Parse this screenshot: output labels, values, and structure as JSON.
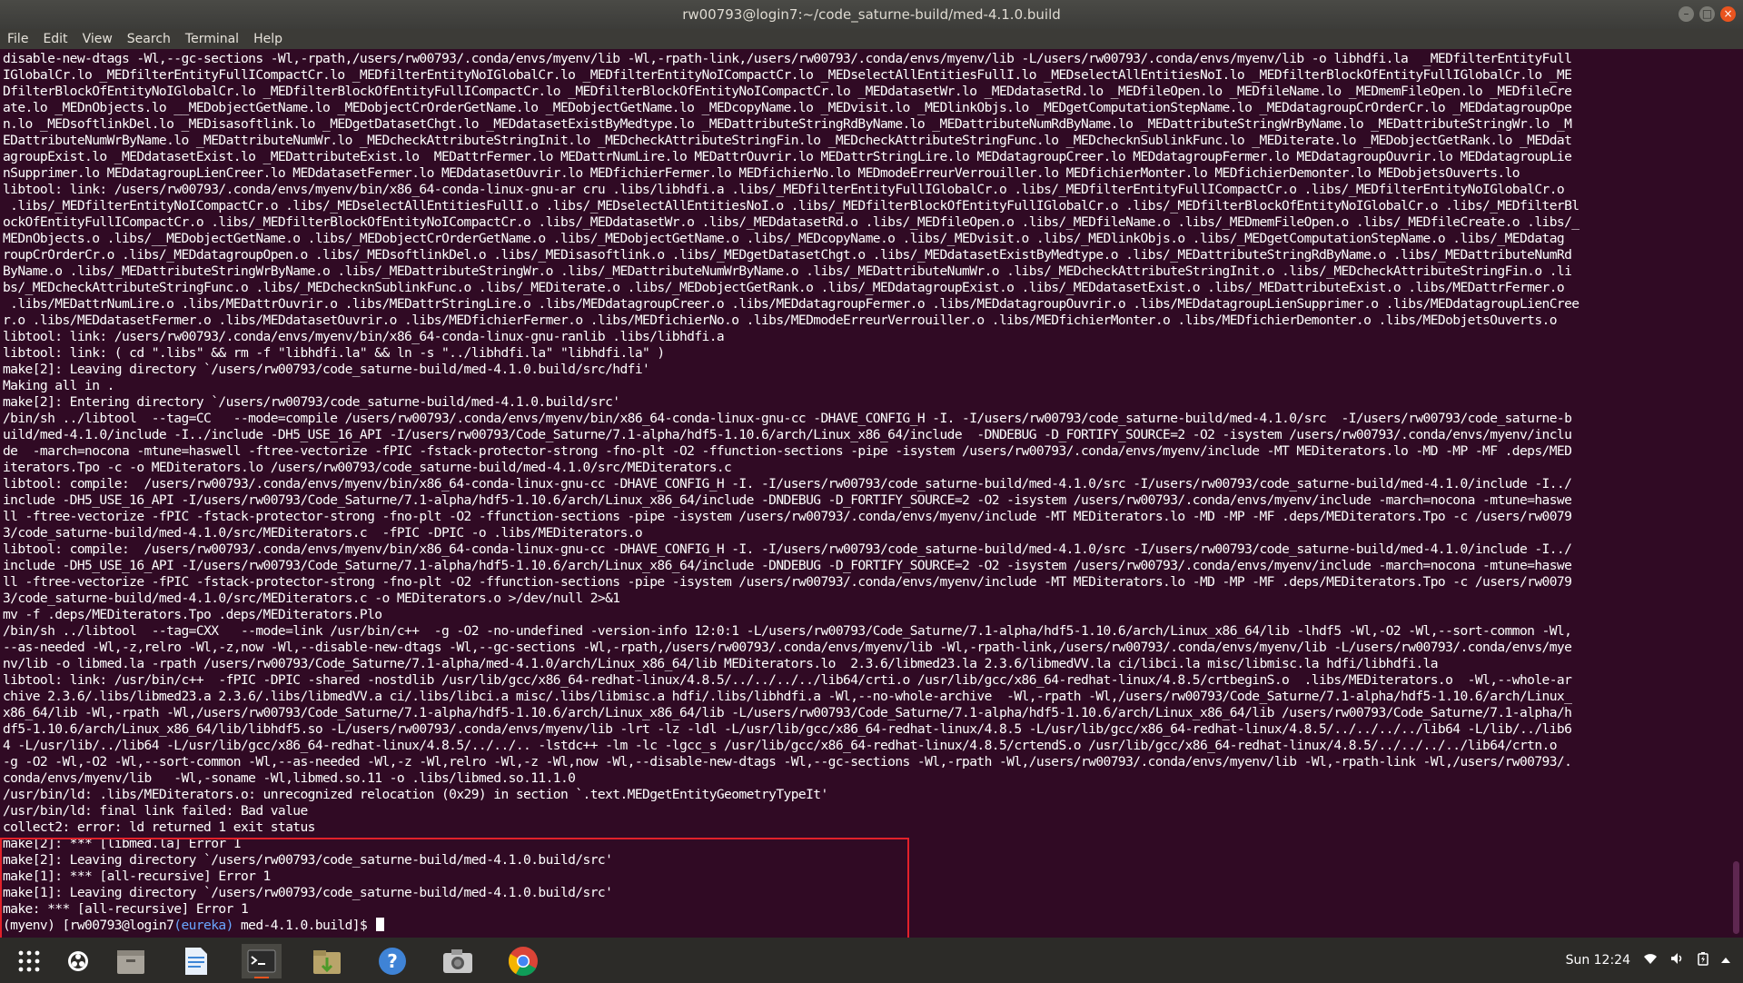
{
  "window": {
    "title": "rw00793@login7:~/code_saturne-build/med-4.1.0.build",
    "minimize": "–",
    "maximize": "□",
    "close": "×"
  },
  "menu": [
    "File",
    "Edit",
    "View",
    "Search",
    "Terminal",
    "Help"
  ],
  "terminal_lines": [
    "disable-new-dtags -Wl,--gc-sections -Wl,-rpath,/users/rw00793/.conda/envs/myenv/lib -Wl,-rpath-link,/users/rw00793/.conda/envs/myenv/lib -L/users/rw00793/.conda/envs/myenv/lib -o libhdfi.la  _MEDfilterEntityFull",
    "IGlobalCr.lo _MEDfilterEntityFullICompactCr.lo _MEDfilterEntityNoIGlobalCr.lo _MEDfilterEntityNoICompactCr.lo _MEDselectAllEntitiesFullI.lo _MEDselectAllEntitiesNoI.lo _MEDfilterBlockOfEntityFullIGlobalCr.lo _ME",
    "DfilterBlockOfEntityNoIGlobalCr.lo _MEDfilterBlockOfEntityFullICompactCr.lo _MEDfilterBlockOfEntityNoICompactCr.lo _MEDdatasetWr.lo _MEDdatasetRd.lo _MEDfileOpen.lo _MEDfileName.lo _MEDmemFileOpen.lo _MEDfileCre",
    "ate.lo _MEDnObjects.lo __MEDobjectGetName.lo _MEDobjectCrOrderGetName.lo _MEDobjectGetName.lo _MEDcopyName.lo _MEDvisit.lo _MEDlinkObjs.lo _MEDgetComputationStepName.lo _MEDdatagroupCrOrderCr.lo _MEDdatagroupOpe",
    "n.lo _MEDsoftlinkDel.lo _MEDisasoftlink.lo _MEDgetDatasetChgt.lo _MEDdatasetExistByMedtype.lo _MEDattributeStringRdByName.lo _MEDattributeNumRdByName.lo _MEDattributeStringWrByName.lo _MEDattributeStringWr.lo _M",
    "EDattributeNumWrByName.lo _MEDattributeNumWr.lo _MEDcheckAttributeStringInit.lo _MEDcheckAttributeStringFin.lo _MEDcheckAttributeStringFunc.lo _MEDchecknSublinkFunc.lo _MEDiterate.lo _MEDobjectGetRank.lo _MEDdat",
    "agroupExist.lo _MEDdatasetExist.lo _MEDattributeExist.lo  MEDattrFermer.lo MEDattrNumLire.lo MEDattrOuvrir.lo MEDattrStringLire.lo MEDdatagroupCreer.lo MEDdatagroupFermer.lo MEDdatagroupOuvrir.lo MEDdatagroupLie",
    "nSupprimer.lo MEDdatagroupLienCreer.lo MEDdatasetFermer.lo MEDdatasetOuvrir.lo MEDfichierFermer.lo MEDfichierNo.lo MEDmodeErreurVerrouiller.lo MEDfichierMonter.lo MEDfichierDemonter.lo MEDobjetsOuverts.lo",
    "libtool: link: /users/rw00793/.conda/envs/myenv/bin/x86_64-conda-linux-gnu-ar cru .libs/libhdfi.a .libs/_MEDfilterEntityFullIGlobalCr.o .libs/_MEDfilterEntityFullICompactCr.o .libs/_MEDfilterEntityNoIGlobalCr.o",
    " .libs/_MEDfilterEntityNoICompactCr.o .libs/_MEDselectAllEntitiesFullI.o .libs/_MEDselectAllEntitiesNoI.o .libs/_MEDfilterBlockOfEntityFullIGlobalCr.o .libs/_MEDfilterBlockOfEntityNoIGlobalCr.o .libs/_MEDfilterBl",
    "ockOfEntityFullICompactCr.o .libs/_MEDfilterBlockOfEntityNoICompactCr.o .libs/_MEDdatasetWr.o .libs/_MEDdatasetRd.o .libs/_MEDfileOpen.o .libs/_MEDfileName.o .libs/_MEDmemFileOpen.o .libs/_MEDfileCreate.o .libs/_",
    "MEDnObjects.o .libs/__MEDobjectGetName.o .libs/_MEDobjectCrOrderGetName.o .libs/_MEDobjectGetName.o .libs/_MEDcopyName.o .libs/_MEDvisit.o .libs/_MEDlinkObjs.o .libs/_MEDgetComputationStepName.o .libs/_MEDdatag",
    "roupCrOrderCr.o .libs/_MEDdatagroupOpen.o .libs/_MEDsoftlinkDel.o .libs/_MEDisasoftlink.o .libs/_MEDgetDatasetChgt.o .libs/_MEDdatasetExistByMedtype.o .libs/_MEDattributeStringRdByName.o .libs/_MEDattributeNumRd",
    "ByName.o .libs/_MEDattributeStringWrByName.o .libs/_MEDattributeStringWr.o .libs/_MEDattributeNumWrByName.o .libs/_MEDattributeNumWr.o .libs/_MEDcheckAttributeStringInit.o .libs/_MEDcheckAttributeStringFin.o .li",
    "bs/_MEDcheckAttributeStringFunc.o .libs/_MEDchecknSublinkFunc.o .libs/_MEDiterate.o .libs/_MEDobjectGetRank.o .libs/_MEDdatagroupExist.o .libs/_MEDdatasetExist.o .libs/_MEDattributeExist.o .libs/MEDattrFermer.o",
    " .libs/MEDattrNumLire.o .libs/MEDattrOuvrir.o .libs/MEDattrStringLire.o .libs/MEDdatagroupCreer.o .libs/MEDdatagroupFermer.o .libs/MEDdatagroupOuvrir.o .libs/MEDdatagroupLienSupprimer.o .libs/MEDdatagroupLienCree",
    "r.o .libs/MEDdatasetFermer.o .libs/MEDdatasetOuvrir.o .libs/MEDfichierFermer.o .libs/MEDfichierNo.o .libs/MEDmodeErreurVerrouiller.o .libs/MEDfichierMonter.o .libs/MEDfichierDemonter.o .libs/MEDobjetsOuverts.o",
    "libtool: link: /users/rw00793/.conda/envs/myenv/bin/x86_64-conda-linux-gnu-ranlib .libs/libhdfi.a",
    "libtool: link: ( cd \".libs\" && rm -f \"libhdfi.la\" && ln -s \"../libhdfi.la\" \"libhdfi.la\" )",
    "make[2]: Leaving directory `/users/rw00793/code_saturne-build/med-4.1.0.build/src/hdfi'",
    "Making all in .",
    "make[2]: Entering directory `/users/rw00793/code_saturne-build/med-4.1.0.build/src'",
    "/bin/sh ../libtool  --tag=CC   --mode=compile /users/rw00793/.conda/envs/myenv/bin/x86_64-conda-linux-gnu-cc -DHAVE_CONFIG_H -I. -I/users/rw00793/code_saturne-build/med-4.1.0/src  -I/users/rw00793/code_saturne-b",
    "uild/med-4.1.0/include -I../include -DH5_USE_16_API -I/users/rw00793/Code_Saturne/7.1-alpha/hdf5-1.10.6/arch/Linux_x86_64/include  -DNDEBUG -D_FORTIFY_SOURCE=2 -O2 -isystem /users/rw00793/.conda/envs/myenv/inclu",
    "de  -march=nocona -mtune=haswell -ftree-vectorize -fPIC -fstack-protector-strong -fno-plt -O2 -ffunction-sections -pipe -isystem /users/rw00793/.conda/envs/myenv/include -MT MEDiterators.lo -MD -MP -MF .deps/MED",
    "iterators.Tpo -c -o MEDiterators.lo /users/rw00793/code_saturne-build/med-4.1.0/src/MEDiterators.c",
    "libtool: compile:  /users/rw00793/.conda/envs/myenv/bin/x86_64-conda-linux-gnu-cc -DHAVE_CONFIG_H -I. -I/users/rw00793/code_saturne-build/med-4.1.0/src -I/users/rw00793/code_saturne-build/med-4.1.0/include -I../",
    "include -DH5_USE_16_API -I/users/rw00793/Code_Saturne/7.1-alpha/hdf5-1.10.6/arch/Linux_x86_64/include -DNDEBUG -D_FORTIFY_SOURCE=2 -O2 -isystem /users/rw00793/.conda/envs/myenv/include -march=nocona -mtune=haswe",
    "ll -ftree-vectorize -fPIC -fstack-protector-strong -fno-plt -O2 -ffunction-sections -pipe -isystem /users/rw00793/.conda/envs/myenv/include -MT MEDiterators.lo -MD -MP -MF .deps/MEDiterators.Tpo -c /users/rw0079",
    "3/code_saturne-build/med-4.1.0/src/MEDiterators.c  -fPIC -DPIC -o .libs/MEDiterators.o",
    "libtool: compile:  /users/rw00793/.conda/envs/myenv/bin/x86_64-conda-linux-gnu-cc -DHAVE_CONFIG_H -I. -I/users/rw00793/code_saturne-build/med-4.1.0/src -I/users/rw00793/code_saturne-build/med-4.1.0/include -I../",
    "include -DH5_USE_16_API -I/users/rw00793/Code_Saturne/7.1-alpha/hdf5-1.10.6/arch/Linux_x86_64/include -DNDEBUG -D_FORTIFY_SOURCE=2 -O2 -isystem /users/rw00793/.conda/envs/myenv/include -march=nocona -mtune=haswe",
    "ll -ftree-vectorize -fPIC -fstack-protector-strong -fno-plt -O2 -ffunction-sections -pipe -isystem /users/rw00793/.conda/envs/myenv/include -MT MEDiterators.lo -MD -MP -MF .deps/MEDiterators.Tpo -c /users/rw0079",
    "3/code_saturne-build/med-4.1.0/src/MEDiterators.c -o MEDiterators.o >/dev/null 2>&1",
    "mv -f .deps/MEDiterators.Tpo .deps/MEDiterators.Plo",
    "/bin/sh ../libtool  --tag=CXX   --mode=link /usr/bin/c++  -g -O2 -no-undefined -version-info 12:0:1 -L/users/rw00793/Code_Saturne/7.1-alpha/hdf5-1.10.6/arch/Linux_x86_64/lib -lhdf5 -Wl,-O2 -Wl,--sort-common -Wl,",
    "--as-needed -Wl,-z,relro -Wl,-z,now -Wl,--disable-new-dtags -Wl,--gc-sections -Wl,-rpath,/users/rw00793/.conda/envs/myenv/lib -Wl,-rpath-link,/users/rw00793/.conda/envs/myenv/lib -L/users/rw00793/.conda/envs/mye",
    "nv/lib -o libmed.la -rpath /users/rw00793/Code_Saturne/7.1-alpha/med-4.1.0/arch/Linux_x86_64/lib MEDiterators.lo  2.3.6/libmed23.la 2.3.6/libmedVV.la ci/libci.la misc/libmisc.la hdfi/libhdfi.la",
    "libtool: link: /usr/bin/c++  -fPIC -DPIC -shared -nostdlib /usr/lib/gcc/x86_64-redhat-linux/4.8.5/../../../../lib64/crti.o /usr/lib/gcc/x86_64-redhat-linux/4.8.5/crtbeginS.o  .libs/MEDiterators.o  -Wl,--whole-ar",
    "chive 2.3.6/.libs/libmed23.a 2.3.6/.libs/libmedVV.a ci/.libs/libci.a misc/.libs/libmisc.a hdfi/.libs/libhdfi.a -Wl,--no-whole-archive  -Wl,-rpath -Wl,/users/rw00793/Code_Saturne/7.1-alpha/hdf5-1.10.6/arch/Linux_",
    "x86_64/lib -Wl,-rpath -Wl,/users/rw00793/Code_Saturne/7.1-alpha/hdf5-1.10.6/arch/Linux_x86_64/lib -L/users/rw00793/Code_Saturne/7.1-alpha/hdf5-1.10.6/arch/Linux_x86_64/lib /users/rw00793/Code_Saturne/7.1-alpha/h",
    "df5-1.10.6/arch/Linux_x86_64/lib/libhdf5.so -L/users/rw00793/.conda/envs/myenv/lib -lrt -lz -ldl -L/usr/lib/gcc/x86_64-redhat-linux/4.8.5 -L/usr/lib/gcc/x86_64-redhat-linux/4.8.5/../../../../lib64 -L/lib/../lib6",
    "4 -L/usr/lib/../lib64 -L/usr/lib/gcc/x86_64-redhat-linux/4.8.5/../../.. -lstdc++ -lm -lc -lgcc_s /usr/lib/gcc/x86_64-redhat-linux/4.8.5/crtendS.o /usr/lib/gcc/x86_64-redhat-linux/4.8.5/../../../../lib64/crtn.o ",
    "-g -O2 -Wl,-O2 -Wl,--sort-common -Wl,--as-needed -Wl,-z -Wl,relro -Wl,-z -Wl,now -Wl,--disable-new-dtags -Wl,--gc-sections -Wl,-rpath -Wl,/users/rw00793/.conda/envs/myenv/lib -Wl,-rpath-link -Wl,/users/rw00793/.",
    "conda/envs/myenv/lib   -Wl,-soname -Wl,libmed.so.11 -o .libs/libmed.so.11.1.0",
    "/usr/bin/ld: .libs/MEDiterators.o: unrecognized relocation (0x29) in section `.text.MEDgetEntityGeometryTypeIt'",
    "/usr/bin/ld: final link failed: Bad value",
    "collect2: error: ld returned 1 exit status",
    "make[2]: *** [libmed.la] Error 1",
    "make[2]: Leaving directory `/users/rw00793/code_saturne-build/med-4.1.0.build/src'",
    "make[1]: *** [all-recursive] Error 1",
    "make[1]: Leaving directory `/users/rw00793/code_saturne-build/med-4.1.0.build/src'",
    "make: *** [all-recursive] Error 1"
  ],
  "prompt": {
    "env": "(myenv) [rw00793@login7",
    "cluster": "(eureka)",
    "cwd": " med-4.1.0.build]$ "
  },
  "taskbar": {
    "apps": [
      "apps-grid-icon",
      "obs-icon",
      "files-icon",
      "document-viewer-icon",
      "terminal-icon",
      "archive-manager-icon",
      "help-icon",
      "camera-icon",
      "chrome-icon"
    ],
    "active_index": 4,
    "clock": "Sun 12:24"
  },
  "colors": {
    "terminal_bg": "#300a24",
    "highlight_border": "#e2212a",
    "cluster_blue": "#6aa6ff"
  }
}
